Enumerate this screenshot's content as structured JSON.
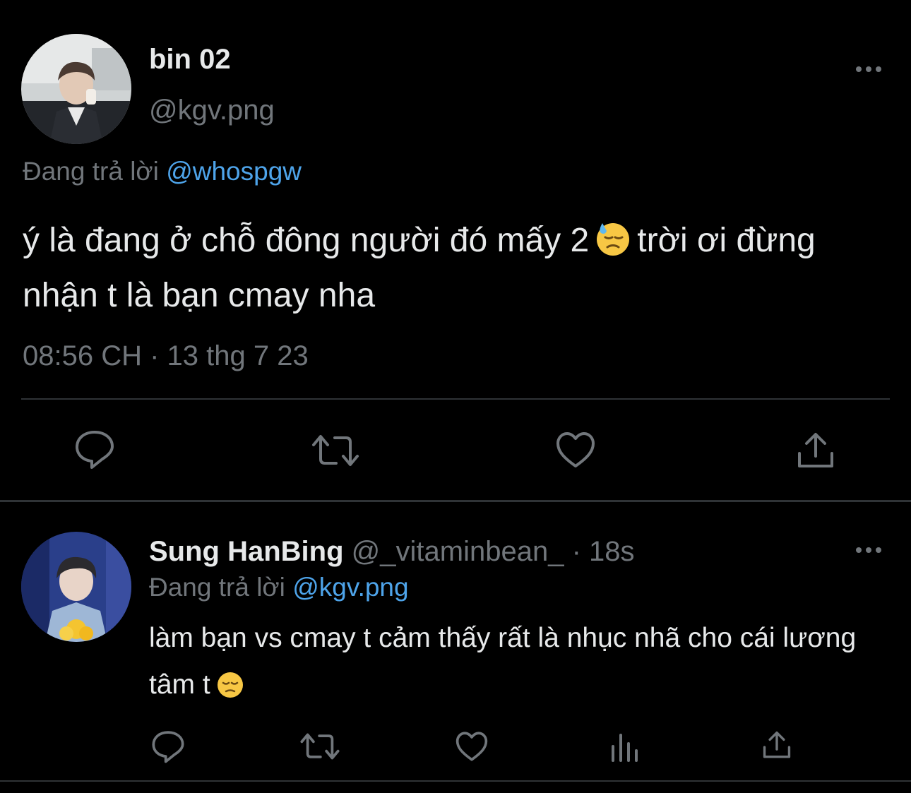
{
  "main_tweet": {
    "display_name": "bin 02",
    "handle": "@kgv.png",
    "replying_to_prefix": "Đang trả lời",
    "replying_to_handle": "@whospgw",
    "text_before_emoji": "ý là đang ở chỗ đông người đó mấy 2",
    "emoji": "downcast-face-with-sweat",
    "text_after_emoji": "trời ơi đừng nhận t là bạn cmay nha",
    "timestamp": "08:56 CH · 13 thg 7 23"
  },
  "reply_tweet": {
    "display_name": "Sung HanBing",
    "handle": "@_vitaminbean_",
    "separator": "·",
    "time_ago": "18s",
    "replying_to_prefix": "Đang trả lời",
    "replying_to_handle": "@kgv.png",
    "text": "làm bạn vs cmay t cảm thấy rất là nhục nhã cho cái lương tâm t",
    "emoji": "pensive-face"
  },
  "icons": {
    "reply": "reply-icon",
    "retweet": "retweet-icon",
    "like": "like-icon",
    "views": "views-icon",
    "share": "share-icon",
    "more": "more-icon"
  },
  "colors": {
    "background": "#000000",
    "primary_text": "#e7e9ea",
    "secondary_text": "#71767b",
    "mention": "#4ea4ea",
    "divider": "#2f3336"
  }
}
